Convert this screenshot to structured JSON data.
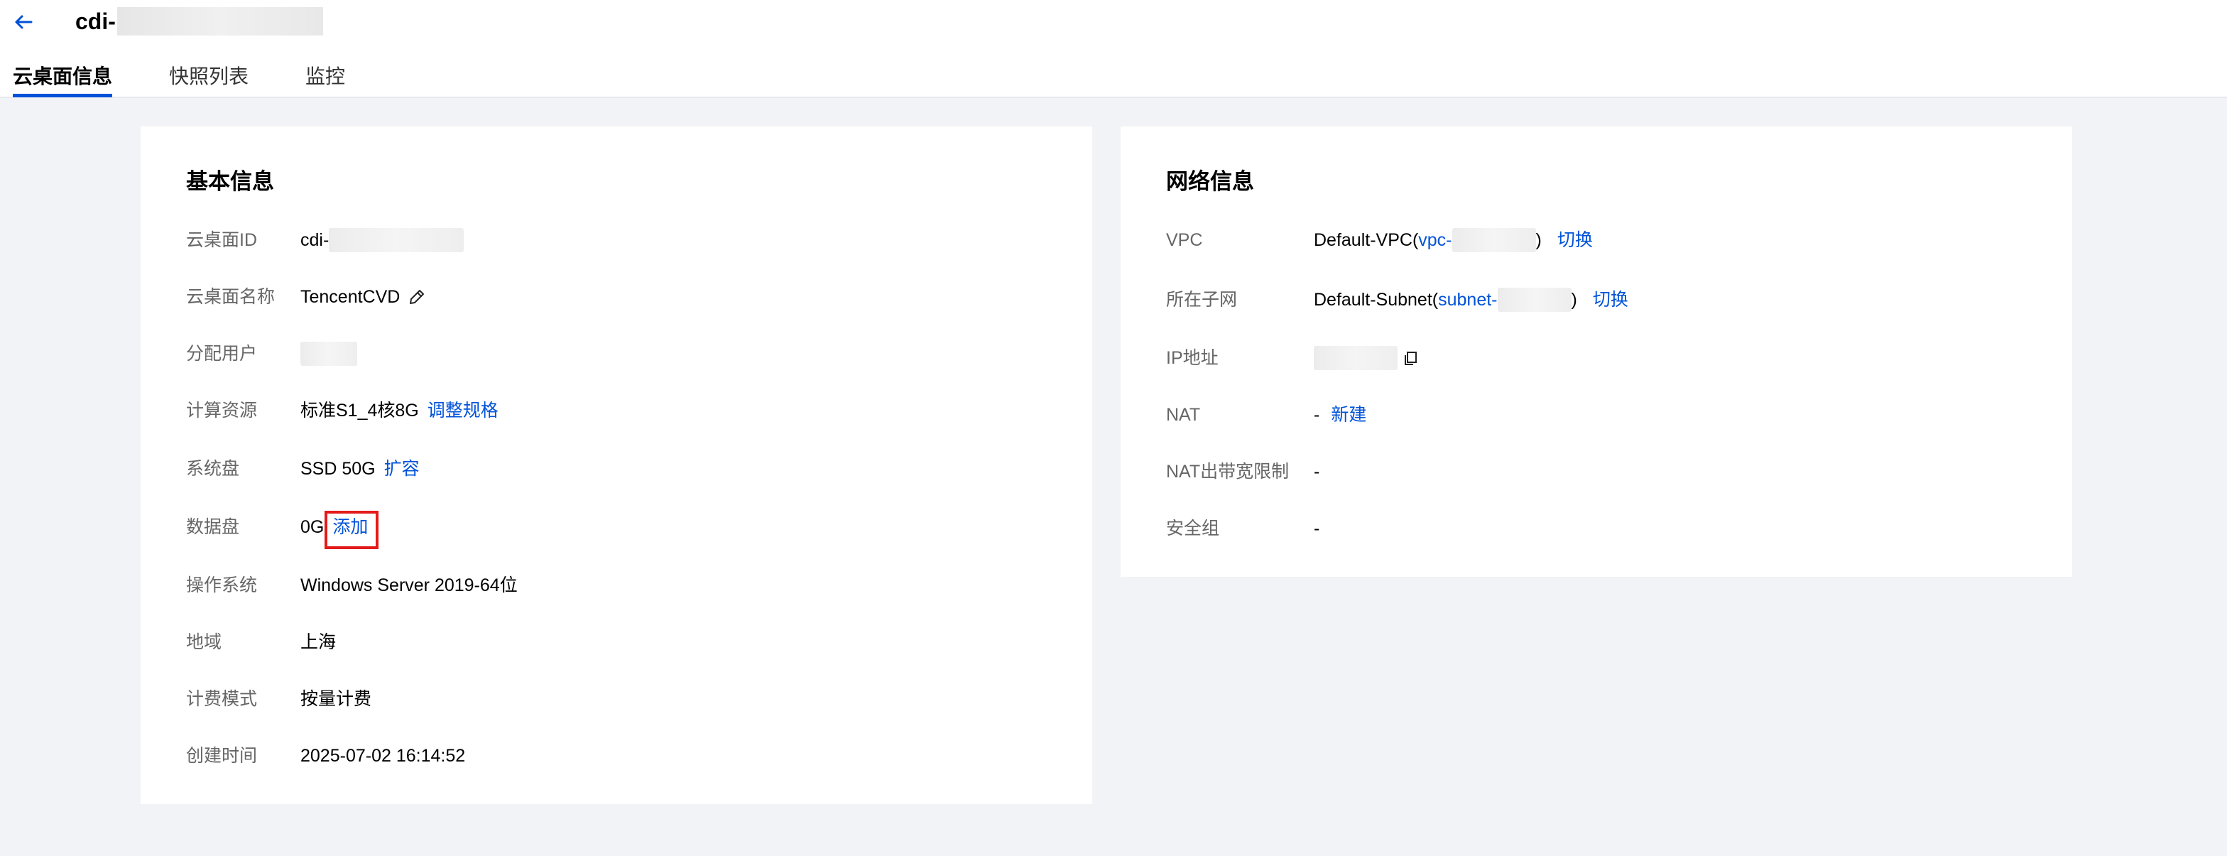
{
  "header": {
    "title": "cdi-",
    "tabs": [
      {
        "label": "云桌面信息",
        "active": true
      },
      {
        "label": "快照列表",
        "active": false
      },
      {
        "label": "监控",
        "active": false
      }
    ]
  },
  "basic_info": {
    "title": "基本信息",
    "rows": {
      "id": {
        "label": "云桌面ID",
        "value": "cdi-"
      },
      "name": {
        "label": "云桌面名称",
        "value": "TencentCVD"
      },
      "user": {
        "label": "分配用户"
      },
      "compute": {
        "label": "计算资源",
        "value": "标准S1_4核8G",
        "action": "调整规格"
      },
      "system_disk": {
        "label": "系统盘",
        "value": "SSD 50G",
        "action": "扩容"
      },
      "data_disk": {
        "label": "数据盘",
        "value": "0G",
        "action": "添加"
      },
      "os": {
        "label": "操作系统",
        "value": "Windows Server 2019-64位"
      },
      "region": {
        "label": "地域",
        "value": "上海"
      },
      "billing": {
        "label": "计费模式",
        "value": "按量计费"
      },
      "created": {
        "label": "创建时间",
        "value": "2025-07-02 16:14:52"
      }
    }
  },
  "network_info": {
    "title": "网络信息",
    "rows": {
      "vpc": {
        "label": "VPC",
        "value_prefix": "Default-VPC(",
        "link_text": "vpc-",
        "value_suffix": ")",
        "action": "切换"
      },
      "subnet": {
        "label": "所在子网",
        "value_prefix": "Default-Subnet(",
        "link_text": "subnet-",
        "value_suffix": ")",
        "action": "切换"
      },
      "ip": {
        "label": "IP地址"
      },
      "nat": {
        "label": "NAT",
        "value": "-",
        "action": "新建"
      },
      "nat_bandwidth": {
        "label": "NAT出带宽限制",
        "value": "-"
      },
      "security_group": {
        "label": "安全组",
        "value": "-"
      }
    }
  },
  "colors": {
    "accent": "#0052d9",
    "highlight": "#e31b1b",
    "background": "#f2f3f6"
  },
  "icons": {
    "back": "arrow-left-icon",
    "edit": "pencil-icon",
    "copy": "copy-icon"
  }
}
